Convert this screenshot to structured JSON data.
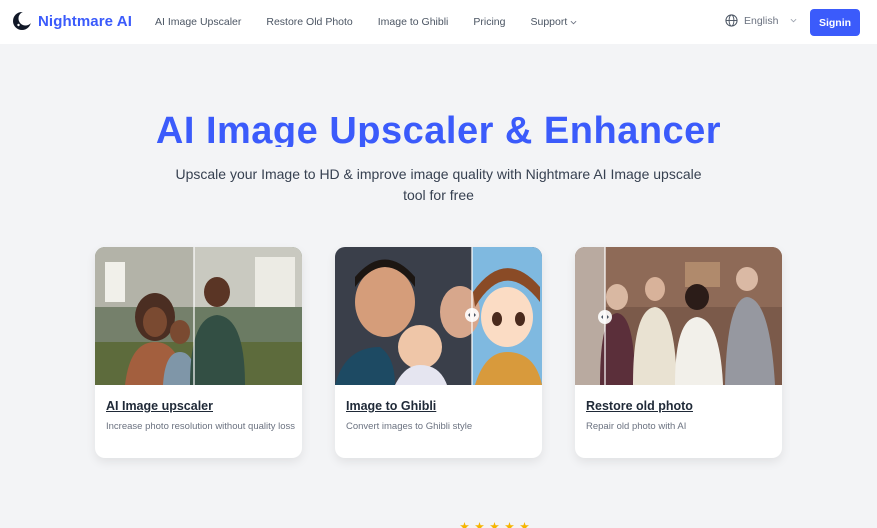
{
  "header": {
    "brand": "Nightmare AI",
    "nav": [
      {
        "label": "AI Image Upscaler"
      },
      {
        "label": "Restore Old Photo"
      },
      {
        "label": "Image to Ghibli"
      },
      {
        "label": "Pricing"
      },
      {
        "label": "Support",
        "has_dropdown": true
      }
    ],
    "language": "English",
    "signin_label": "Signin"
  },
  "hero": {
    "title": "AI Image Upscaler & Enhancer",
    "subtitle": "Upscale your Image to HD & improve image quality with Nightmare AI Image upscale tool for free"
  },
  "cards": [
    {
      "title": "AI Image upscaler",
      "description": "Increase photo resolution without quality loss"
    },
    {
      "title": "Image to Ghibli",
      "description": "Convert images to Ghibli style"
    },
    {
      "title": "Restore old photo",
      "description": "Repair old photo with AI"
    }
  ],
  "colors": {
    "accent": "#3b5bfb",
    "background": "#f3f4f6",
    "star": "#f5b400"
  },
  "icons": {
    "logo": "moon-logo-icon",
    "language": "globe-icon",
    "dropdown": "chevron-down-icon",
    "compare": "compare-slider-icon",
    "rating": "star-icon"
  }
}
